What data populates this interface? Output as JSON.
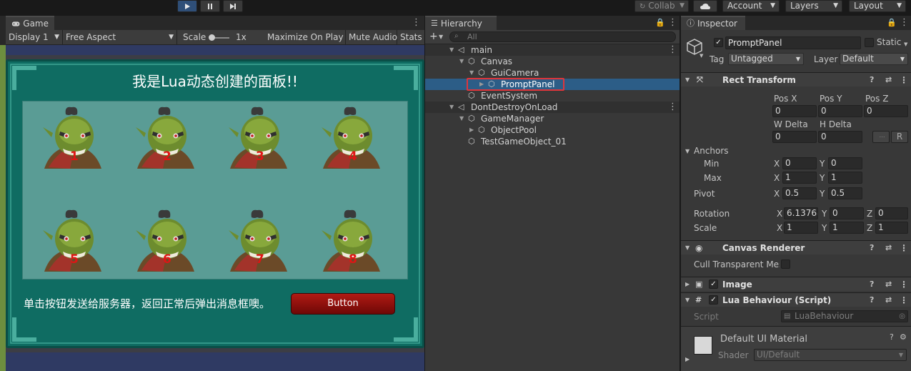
{
  "topbar": {
    "collab_label": "Collab",
    "account_label": "Account",
    "layers_label": "Layers",
    "layout_label": "Layout"
  },
  "game_view": {
    "tab_label": "Game",
    "display": "Display 1",
    "aspect": "Free Aspect",
    "scale_label": "Scale",
    "scale_value": "1x",
    "maximize_label": "Maximize On Play",
    "mute_label": "Mute Audio",
    "stats_label": "Stats",
    "panel_title": "我是Lua动态创建的面板!!",
    "tiles": [
      "1",
      "2",
      "3",
      "4",
      "5",
      "6",
      "7",
      "8"
    ],
    "prompt_text": "单击按钮发送给服务器，返回正常后弹出消息框噢。",
    "button_label": "Button"
  },
  "hierarchy": {
    "tab_label": "Hierarchy",
    "search_placeholder": "All",
    "items": [
      {
        "label": "main"
      },
      {
        "label": "Canvas"
      },
      {
        "label": "GuiCamera"
      },
      {
        "label": "PromptPanel"
      },
      {
        "label": "EventSystem"
      },
      {
        "label": "DontDestroyOnLoad"
      },
      {
        "label": "GameManager"
      },
      {
        "label": "ObjectPool"
      },
      {
        "label": "TestGameObject_01"
      }
    ]
  },
  "inspector": {
    "tab_label": "Inspector",
    "object_name": "PromptPanel",
    "static_label": "Static",
    "tag_label": "Tag",
    "tag_value": "Untagged",
    "layer_label": "Layer",
    "layer_value": "Default",
    "rect_transform": {
      "title": "Rect Transform",
      "pos_x_label": "Pos X",
      "pos_y_label": "Pos Y",
      "pos_z_label": "Pos Z",
      "pos_x": "0",
      "pos_y": "0",
      "pos_z": "0",
      "w_delta_label": "W Delta",
      "h_delta_label": "H Delta",
      "w_delta": "0",
      "h_delta": "0",
      "r_label": "R",
      "anchors_label": "Anchors",
      "min_label": "Min",
      "max_label": "Max",
      "x_label": "X",
      "y_label": "Y",
      "z_label": "Z",
      "min_x": "0",
      "min_y": "0",
      "max_x": "1",
      "max_y": "1",
      "pivot_label": "Pivot",
      "pivot_x": "0.5",
      "pivot_y": "0.5",
      "rotation_label": "Rotation",
      "rot_x": "6.13768",
      "rot_y": "0",
      "rot_z": "0",
      "scale_label": "Scale",
      "scale_x": "1",
      "scale_y": "1",
      "scale_z": "1"
    },
    "canvas_renderer": {
      "title": "Canvas Renderer",
      "cull_label": "Cull Transparent Mes"
    },
    "image": {
      "title": "Image"
    },
    "lua_behaviour": {
      "title": "Lua Behaviour (Script)",
      "script_label": "Script",
      "script_value": "LuaBehaviour"
    },
    "material": {
      "name": "Default UI Material",
      "shader_label": "Shader",
      "shader_value": "UI/Default"
    }
  },
  "colors": {
    "accent_selection": "#2c5d87",
    "highlight_box": "#e0353b",
    "panel_teal": "#0f6c62"
  }
}
